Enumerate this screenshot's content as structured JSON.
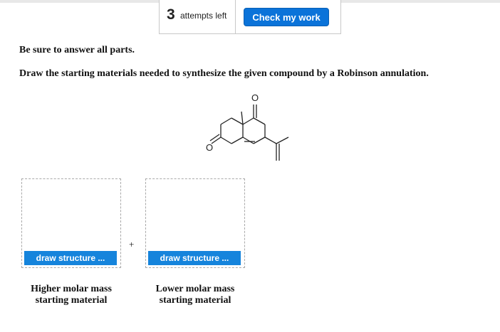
{
  "header": {
    "attempts_count": "3",
    "attempts_label": "attempts left",
    "check_button": "Check my work"
  },
  "instructions": {
    "line1": "Be sure to answer all parts.",
    "line2": "Draw the starting materials needed to synthesize the given compound by a Robinson annulation."
  },
  "molecule": {
    "atoms": [
      "O",
      "O"
    ]
  },
  "answers": {
    "left": {
      "button": "draw structure ...",
      "caption_line1": "Higher molar mass",
      "caption_line2": "starting material"
    },
    "plus": "+",
    "right": {
      "button": "draw structure ...",
      "caption_line1": "Lower molar mass",
      "caption_line2": "starting material"
    }
  }
}
